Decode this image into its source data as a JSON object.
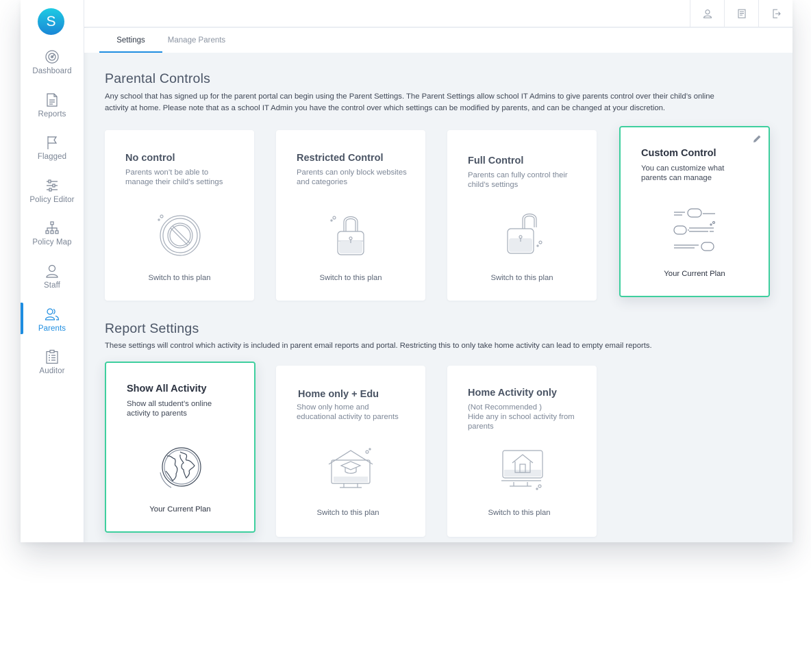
{
  "sidebar": {
    "avatar_letter": "S",
    "items": [
      {
        "label": "Dashboard",
        "icon": "gauge-icon"
      },
      {
        "label": "Reports",
        "icon": "document-icon"
      },
      {
        "label": "Flagged",
        "icon": "flag-icon"
      },
      {
        "label": "Policy Editor",
        "icon": "sliders-icon"
      },
      {
        "label": "Policy Map",
        "icon": "sitemap-icon"
      },
      {
        "label": "Staff",
        "icon": "user-icon"
      },
      {
        "label": "Parents",
        "icon": "users-icon",
        "active": true
      },
      {
        "label": "Auditor",
        "icon": "clipboard-icon"
      }
    ]
  },
  "topbar": {
    "icons": [
      "user-profile-icon",
      "notes-icon",
      "logout-icon"
    ]
  },
  "tabs": [
    {
      "label": "Settings",
      "active": true
    },
    {
      "label": "Manage Parents",
      "active": false
    }
  ],
  "parental_controls": {
    "title": "Parental Controls",
    "description_line1": "Any school that has signed up for the parent portal can begin using the Parent Settings. The Parent Settings allow school IT Admins to give parents control over their child’s online",
    "description_line2": "activity at home. Please note that as a school IT Admin you have the control over which settings can be modified by parents, and can be changed at your discretion.",
    "cards": [
      {
        "title": "No control",
        "desc": "Parents won’t be able to manage their child’s settings",
        "action": "Switch to this plan",
        "icon": "prohibited-icon"
      },
      {
        "title": "Restricted Control",
        "desc": "Parents can only block websites and categories",
        "action": "Switch to this plan",
        "icon": "padlock-locked-icon"
      },
      {
        "title": "Full Control",
        "desc": "Parents can fully control their child’s settings",
        "action": "Switch to this plan",
        "icon": "padlock-open-icon"
      },
      {
        "title": "Custom Control",
        "desc": "You can customize what parents can manage",
        "action": "Your Current Plan",
        "icon": "toggles-icon",
        "selected": true
      }
    ]
  },
  "report_settings": {
    "title": "Report Settings",
    "description": "These settings will control which activity is included in parent email reports and portal. Restricting this to only take home activity can lead to empty email reports.",
    "cards": [
      {
        "title": "Show All Activity",
        "desc": "Show all student’s online activity to parents",
        "action": "Your Current Plan",
        "icon": "globe-icon",
        "selected": true
      },
      {
        "title": "Home only + Edu",
        "desc": "Show only  home  and educational activity to parents",
        "action": "Switch to this plan",
        "icon": "home-education-monitor-icon"
      },
      {
        "title": "Home Activity only",
        "desc_line1": "(Not Recommended )",
        "desc_line2": "Hide any in school activity from parents",
        "action": "Switch to this plan",
        "icon": "home-monitor-icon"
      }
    ]
  },
  "colors": {
    "accent": "#1e8de0",
    "selected_border": "#3ecf9e",
    "background": "#f1f4f7"
  }
}
